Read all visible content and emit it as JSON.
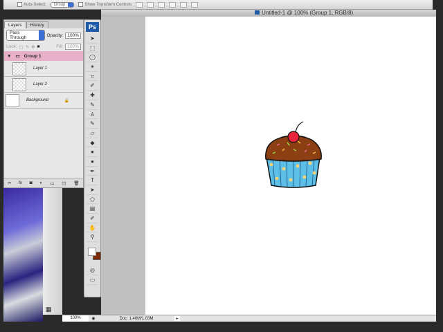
{
  "options_bar": {
    "auto_select": "Auto-Select:",
    "auto_select_value": "Group",
    "show_transform": "Show Transform Controls"
  },
  "document": {
    "title": "Untitled-1 @ 100% (Group 1, RGB/8)"
  },
  "layers_panel": {
    "tabs": [
      "Layers",
      "History"
    ],
    "blend_mode": "Pass Through",
    "opacity_label": "Opacity:",
    "opacity": "100%",
    "lock_label": "Lock:",
    "fill_label": "Fill:",
    "fill": "100%",
    "group": "Group 1",
    "layers": [
      "Layer 1",
      "Layer 2"
    ],
    "background": "Background",
    "bottom_icons": [
      "link",
      "fx",
      "mask",
      "adjustment",
      "folder",
      "new-layer",
      "trash"
    ]
  },
  "toolbox": {
    "logo": "Ps",
    "tools": [
      "move",
      "marquee",
      "lasso",
      "magic-wand",
      "crop",
      "slice",
      "healing",
      "brush",
      "stamp",
      "history-brush",
      "eraser",
      "bucket",
      "blur",
      "dodge",
      "pen",
      "type",
      "path-select",
      "shape",
      "notes",
      "eyedropper",
      "hand",
      "zoom"
    ],
    "foreground": "#ffffff",
    "background": "#7a2a08"
  },
  "status": {
    "zoom": "100%",
    "doc": "Doc: 1.40M/1.03M"
  },
  "colors": {
    "group_highlight": "#e8afc8",
    "canvas": "#ffffff"
  }
}
